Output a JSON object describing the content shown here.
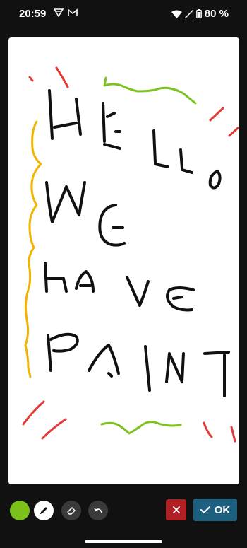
{
  "status_bar": {
    "time": "20:59",
    "left_icons": [
      "vpn-key-icon",
      "gmail-icon"
    ],
    "right_icons": [
      "wifi-icon",
      "signal-icon",
      "battery-icon"
    ],
    "battery": "80 %"
  },
  "canvas": {
    "stroke_colors": {
      "black": "#111111",
      "red": "#e53935",
      "green": "#7cc31e",
      "yellow": "#f2b400"
    }
  },
  "toolbar": {
    "selected_color": "#7ac11c",
    "tools": [
      "color-swatch",
      "pen-icon",
      "eraser-icon",
      "undo-icon"
    ],
    "cancel_icon": "close-icon",
    "ok_label": "OK"
  }
}
